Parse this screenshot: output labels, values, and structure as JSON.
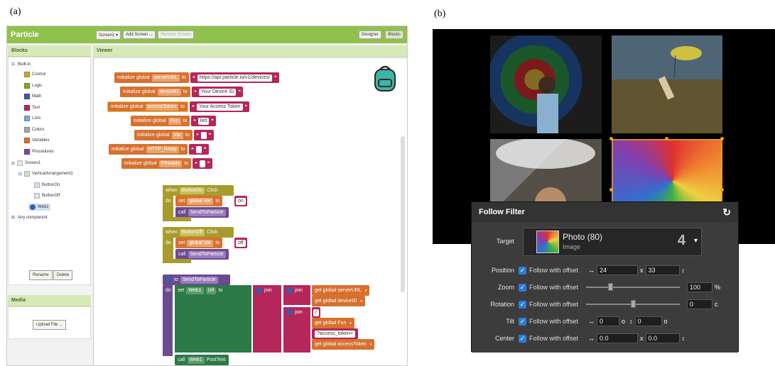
{
  "labels": {
    "a": "(a)",
    "b": "(b)"
  },
  "appinventor": {
    "project": "Particle",
    "screen_dropdown": "Screen1 ▾",
    "add_screen": "Add Screen ...",
    "remove_screen": "Remove Screen",
    "designer": "Designer",
    "blocks_btn": "Blocks",
    "blocks_header": "Blocks",
    "viewer_header": "Viewer",
    "builtin": "Built-in",
    "builtin_items": [
      {
        "label": "Control",
        "color": "#c8a43a"
      },
      {
        "label": "Logic",
        "color": "#7aa630"
      },
      {
        "label": "Math",
        "color": "#3a5ba8"
      },
      {
        "label": "Text",
        "color": "#b5265b"
      },
      {
        "label": "Lists",
        "color": "#78a8d8"
      },
      {
        "label": "Colors",
        "color": "#a6a6a6"
      },
      {
        "label": "Variables",
        "color": "#d7712f"
      },
      {
        "label": "Procedures",
        "color": "#7a4a9e"
      }
    ],
    "screen1": "Screen1",
    "vertical_arrangement": "VerticalArrangement1",
    "button_on": "ButtonOn",
    "button_off": "ButtonOff",
    "web1": "Web1",
    "any_component": "Any component",
    "rename": "Rename",
    "delete": "Delete",
    "media_header": "Media",
    "upload_file": "Upload File ...",
    "globals": [
      {
        "init": "initialize global",
        "name": "serverURL",
        "to": "to",
        "value": "https://api.particle.io/v1/devices/"
      },
      {
        "init": "initialize global",
        "name": "deviceID",
        "to": "to",
        "value": "Your Device ID"
      },
      {
        "init": "initialize global",
        "name": "accessToken",
        "to": "to",
        "value": "Your Access Token"
      },
      {
        "init": "initialize global",
        "name": "Fun",
        "to": "to",
        "value": "led"
      },
      {
        "init": "initialize global",
        "name": "Var",
        "to": "to",
        "value": ""
      },
      {
        "init": "initialize global",
        "name": "HTTP_Reply",
        "to": "to",
        "value": ""
      },
      {
        "init": "initialize global",
        "name": "PINstate",
        "to": "to",
        "value": ""
      }
    ],
    "ev_on": {
      "when": "when",
      "comp": "ButtonOn",
      "event": "Click",
      "do": "do",
      "set": "set",
      "var": "global Var",
      "to": "to",
      "value": "on",
      "call": "call",
      "proc": "SendToParticle"
    },
    "ev_off": {
      "when": "when",
      "comp": "ButtonOff",
      "event": "Click",
      "do": "do",
      "set": "set",
      "var": "global Var",
      "to": "to",
      "value": "off",
      "call": "call",
      "proc": "SendToParticle"
    },
    "proc": {
      "to": "to",
      "name": "SendToParticle",
      "do": "do",
      "set": "set",
      "comp": "Web1",
      "prop": "Url",
      "to2": "to",
      "join": "join",
      "get_server": "get global serverURL",
      "get_device": "get global deviceID",
      "slash": "/",
      "get_fun": "get global Fun",
      "token_str": "?access_token=",
      "get_token": "get global accessToken",
      "call": "call",
      "call_target": "Web1",
      "post": "PostText"
    }
  },
  "editor": {
    "panel_title": "Follow Filter",
    "target_label": "Target",
    "target_name": "Photo (80)",
    "target_type": "Image",
    "target_number": "4",
    "follow_text": "Follow with offset",
    "rows": [
      {
        "label": "Position",
        "v1": "24",
        "sep": "x",
        "v2": "33"
      },
      {
        "label": "Zoom",
        "value": "100",
        "unit": "%",
        "level": 0.25
      },
      {
        "label": "Rotation",
        "value": "0",
        "unit": "c",
        "level": 0.5
      },
      {
        "label": "Tilt",
        "v1": "0",
        "v2": "0",
        "unit": "o"
      },
      {
        "label": "Center",
        "v1": "0.0",
        "sep": "x",
        "v2": "0.0"
      }
    ]
  }
}
